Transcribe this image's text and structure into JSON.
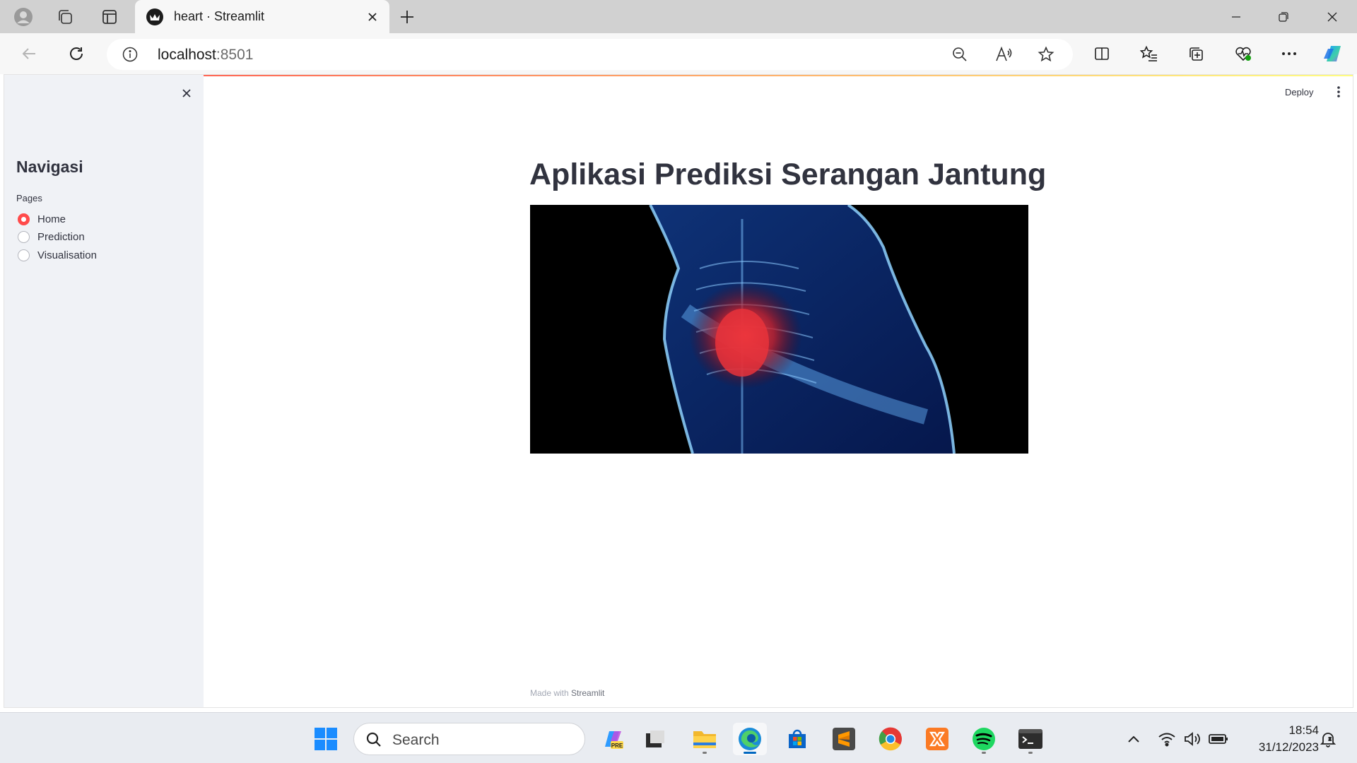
{
  "browser": {
    "tab_title": "heart · Streamlit",
    "url_host": "localhost",
    "url_port": ":8501"
  },
  "sidebar": {
    "title": "Navigasi",
    "pages_label": "Pages",
    "options": [
      {
        "label": "Home",
        "selected": true
      },
      {
        "label": "Prediction",
        "selected": false
      },
      {
        "label": "Visualisation",
        "selected": false
      }
    ]
  },
  "header": {
    "deploy_label": "Deploy"
  },
  "main": {
    "title": "Aplikasi Prediksi Serangan Jantung"
  },
  "footer": {
    "made_with": "Made with ",
    "brand": "Streamlit"
  },
  "taskbar": {
    "search_label": "Search",
    "time": "18:54",
    "date": "31/12/2023"
  },
  "colors": {
    "accent": "#ff4b4b",
    "sidebar_bg": "#f0f2f6",
    "text": "#31333f"
  }
}
